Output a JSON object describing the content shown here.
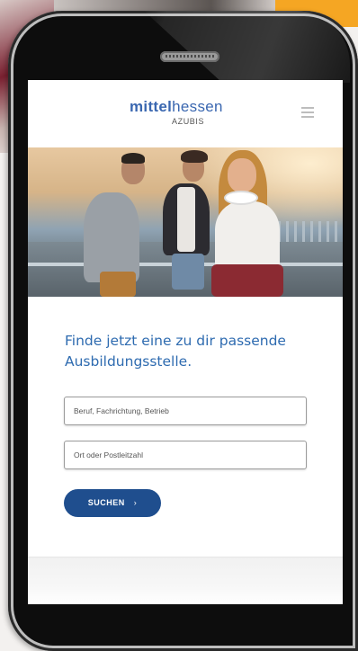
{
  "header": {
    "logo_prefix": "mittel",
    "logo_suffix": "hessen",
    "logo_sub": "AZUBIS"
  },
  "hero": {
    "image": "three-young-people-walking-on-bridge"
  },
  "search": {
    "headline": "Finde jetzt eine zu dir passende Ausbildungsstelle.",
    "job_placeholder": "Beruf, Fachrichtung, Betrieb",
    "location_placeholder": "Ort oder Postleitzahl",
    "button_label": "SUCHEN",
    "button_chevron": "›"
  },
  "colors": {
    "brand_blue": "#2e6bb0",
    "button_blue": "#1f4e8e",
    "accent_orange": "#f5a623"
  },
  "icons": {
    "menu": "hamburger-menu-icon"
  }
}
